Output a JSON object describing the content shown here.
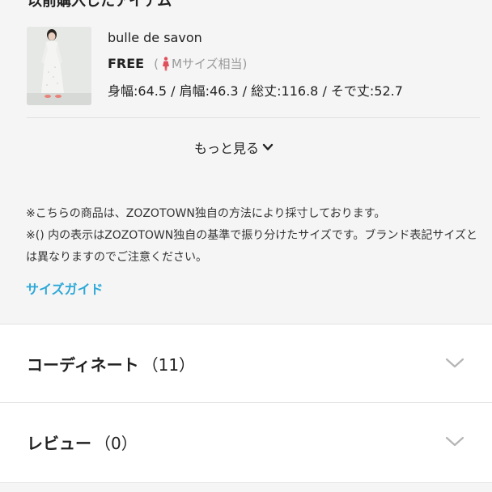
{
  "previous_items": {
    "heading": "以前購入したアイテム",
    "items": [
      {
        "brand": "bulle de savon",
        "size_label": "FREE",
        "size_equiv_open": "(",
        "size_equiv_text": "Mサイズ相当)",
        "measurements": "身幅:64.5 / 肩幅:46.3 / 総丈:116.8 / そで丈:52.7"
      }
    ],
    "more_label": "もっと見る"
  },
  "notes": {
    "line1": "※こちらの商品は、ZOZOTOWN独自の方法により採寸しております。",
    "line2": "※() 内の表示はZOZOTOWN独自の基準で振り分けたサイズです。ブランド表記サイズとは異なりますのでご注意ください。",
    "size_guide_link": "サイズガイド"
  },
  "accordions": [
    {
      "label": "コーディネート",
      "count": "（11）"
    },
    {
      "label": "レビュー",
      "count": "（0）"
    }
  ],
  "colors": {
    "accent_link": "#2ea8d8",
    "person_icon": "#e0505a",
    "background": "#f5f5f5",
    "card": "#ffffff"
  },
  "icons": {
    "size_person": "woman-silhouette-icon",
    "more_chevron": "chevron-down-icon",
    "accordion_chevron": "chevron-down-icon"
  }
}
